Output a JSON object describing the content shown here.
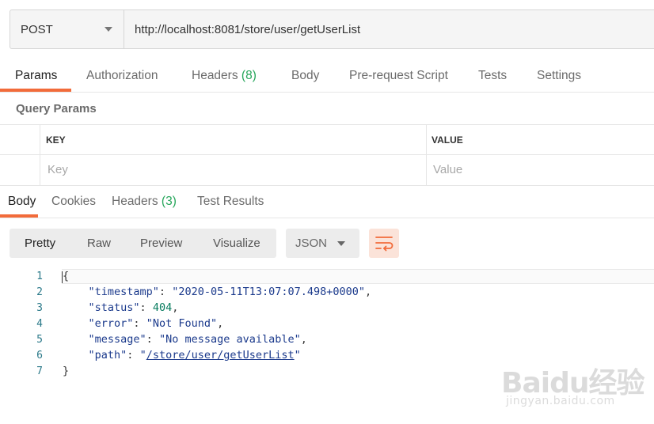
{
  "request": {
    "method": "POST",
    "url": "http://localhost:8081/store/user/getUserList"
  },
  "request_tabs": [
    {
      "label": "Params",
      "count": ""
    },
    {
      "label": "Authorization",
      "count": ""
    },
    {
      "label": "Headers",
      "count": "(8)"
    },
    {
      "label": "Body",
      "count": ""
    },
    {
      "label": "Pre-request Script",
      "count": ""
    },
    {
      "label": "Tests",
      "count": ""
    },
    {
      "label": "Settings",
      "count": ""
    }
  ],
  "query_params": {
    "title": "Query Params",
    "columns": [
      "KEY",
      "VALUE"
    ],
    "placeholders": [
      "Key",
      "Value"
    ]
  },
  "response_tabs": [
    {
      "label": "Body",
      "count": ""
    },
    {
      "label": "Cookies",
      "count": ""
    },
    {
      "label": "Headers",
      "count": "(3)"
    },
    {
      "label": "Test Results",
      "count": ""
    }
  ],
  "view_modes": [
    "Pretty",
    "Raw",
    "Preview",
    "Visualize"
  ],
  "format": "JSON",
  "icons": {
    "wrap": "wrap-lines-icon",
    "method_caret": "chevron-down-icon",
    "format_caret": "chevron-down-icon"
  },
  "colors": {
    "accent": "#f26b3a",
    "count": "#26a65b"
  },
  "response_body": {
    "line_numbers": [
      "1",
      "2",
      "3",
      "4",
      "5",
      "6",
      "7"
    ],
    "open_brace": "{",
    "close_brace": "}",
    "fields": [
      {
        "key": "\"timestamp\"",
        "value": "\"2020-05-11T13:07:07.498+0000\"",
        "type": "string",
        "trail": ","
      },
      {
        "key": "\"status\"",
        "value": "404",
        "type": "number",
        "trail": ","
      },
      {
        "key": "\"error\"",
        "value": "\"Not Found\"",
        "type": "string",
        "trail": ","
      },
      {
        "key": "\"message\"",
        "value": "\"No message available\"",
        "type": "string",
        "trail": ","
      },
      {
        "key": "\"path\"",
        "value": "/store/user/getUserList",
        "type": "url",
        "trail": ""
      }
    ]
  },
  "watermark": {
    "brand": "Baidu经验",
    "sub": "jingyan.baidu.com"
  }
}
